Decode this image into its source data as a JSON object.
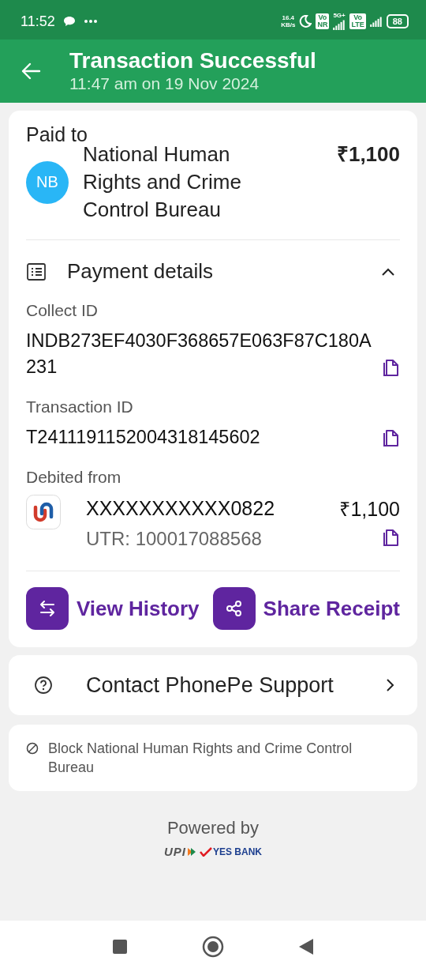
{
  "status_bar": {
    "time": "11:52",
    "speed_value": "16.4",
    "speed_unit": "KB/s",
    "sims": [
      {
        "badge_top": "Vo",
        "badge_bottom": "NR",
        "network": "5G+"
      },
      {
        "badge_top": "Vo",
        "badge_bottom": "LTE"
      }
    ],
    "battery": "88"
  },
  "header": {
    "title": "Transaction Successful",
    "subtitle": "11:47 am on 19 Nov 2024"
  },
  "payee": {
    "label": "Paid to",
    "initials": "NB",
    "name": "National Human Rights and Crime Control Bureau",
    "amount": "₹1,100"
  },
  "payment_details": {
    "title": "Payment details",
    "expanded": true,
    "fields": [
      {
        "label": "Collect ID",
        "value": "INDB273EF4030F368657E063F87C180A231"
      },
      {
        "label": "Transaction ID",
        "value": "T2411191152004318145602"
      }
    ],
    "debited_from": {
      "label": "Debited from",
      "account": "XXXXXXXXXXX0822",
      "amount": "₹1,100",
      "utr": "UTR: 100017088568"
    }
  },
  "actions": [
    {
      "kind": "history",
      "label": "View History"
    },
    {
      "kind": "share",
      "label": "Share Receipt"
    }
  ],
  "support": {
    "label": "Contact PhonePe Support"
  },
  "block": {
    "label": "Block National Human Rights and Crime Control Bureau"
  },
  "footer": {
    "powered_by": "Powered by",
    "logos": [
      "UPI",
      "YES BANK"
    ]
  }
}
